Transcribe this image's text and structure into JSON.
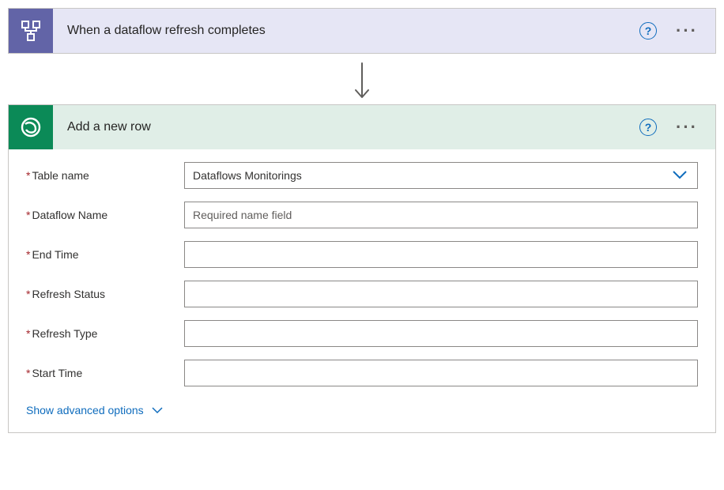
{
  "trigger": {
    "title": "When a dataflow refresh completes"
  },
  "action": {
    "title": "Add a new row",
    "fields": {
      "table_name": {
        "label": "Table name",
        "value": "Dataflows Monitorings"
      },
      "dataflow_name": {
        "label": "Dataflow Name",
        "placeholder": "Required name field",
        "value": ""
      },
      "end_time": {
        "label": "End Time",
        "value": ""
      },
      "refresh_status": {
        "label": "Refresh Status",
        "value": ""
      },
      "refresh_type": {
        "label": "Refresh Type",
        "value": ""
      },
      "start_time": {
        "label": "Start Time",
        "value": ""
      }
    },
    "advanced_label": "Show advanced options"
  }
}
